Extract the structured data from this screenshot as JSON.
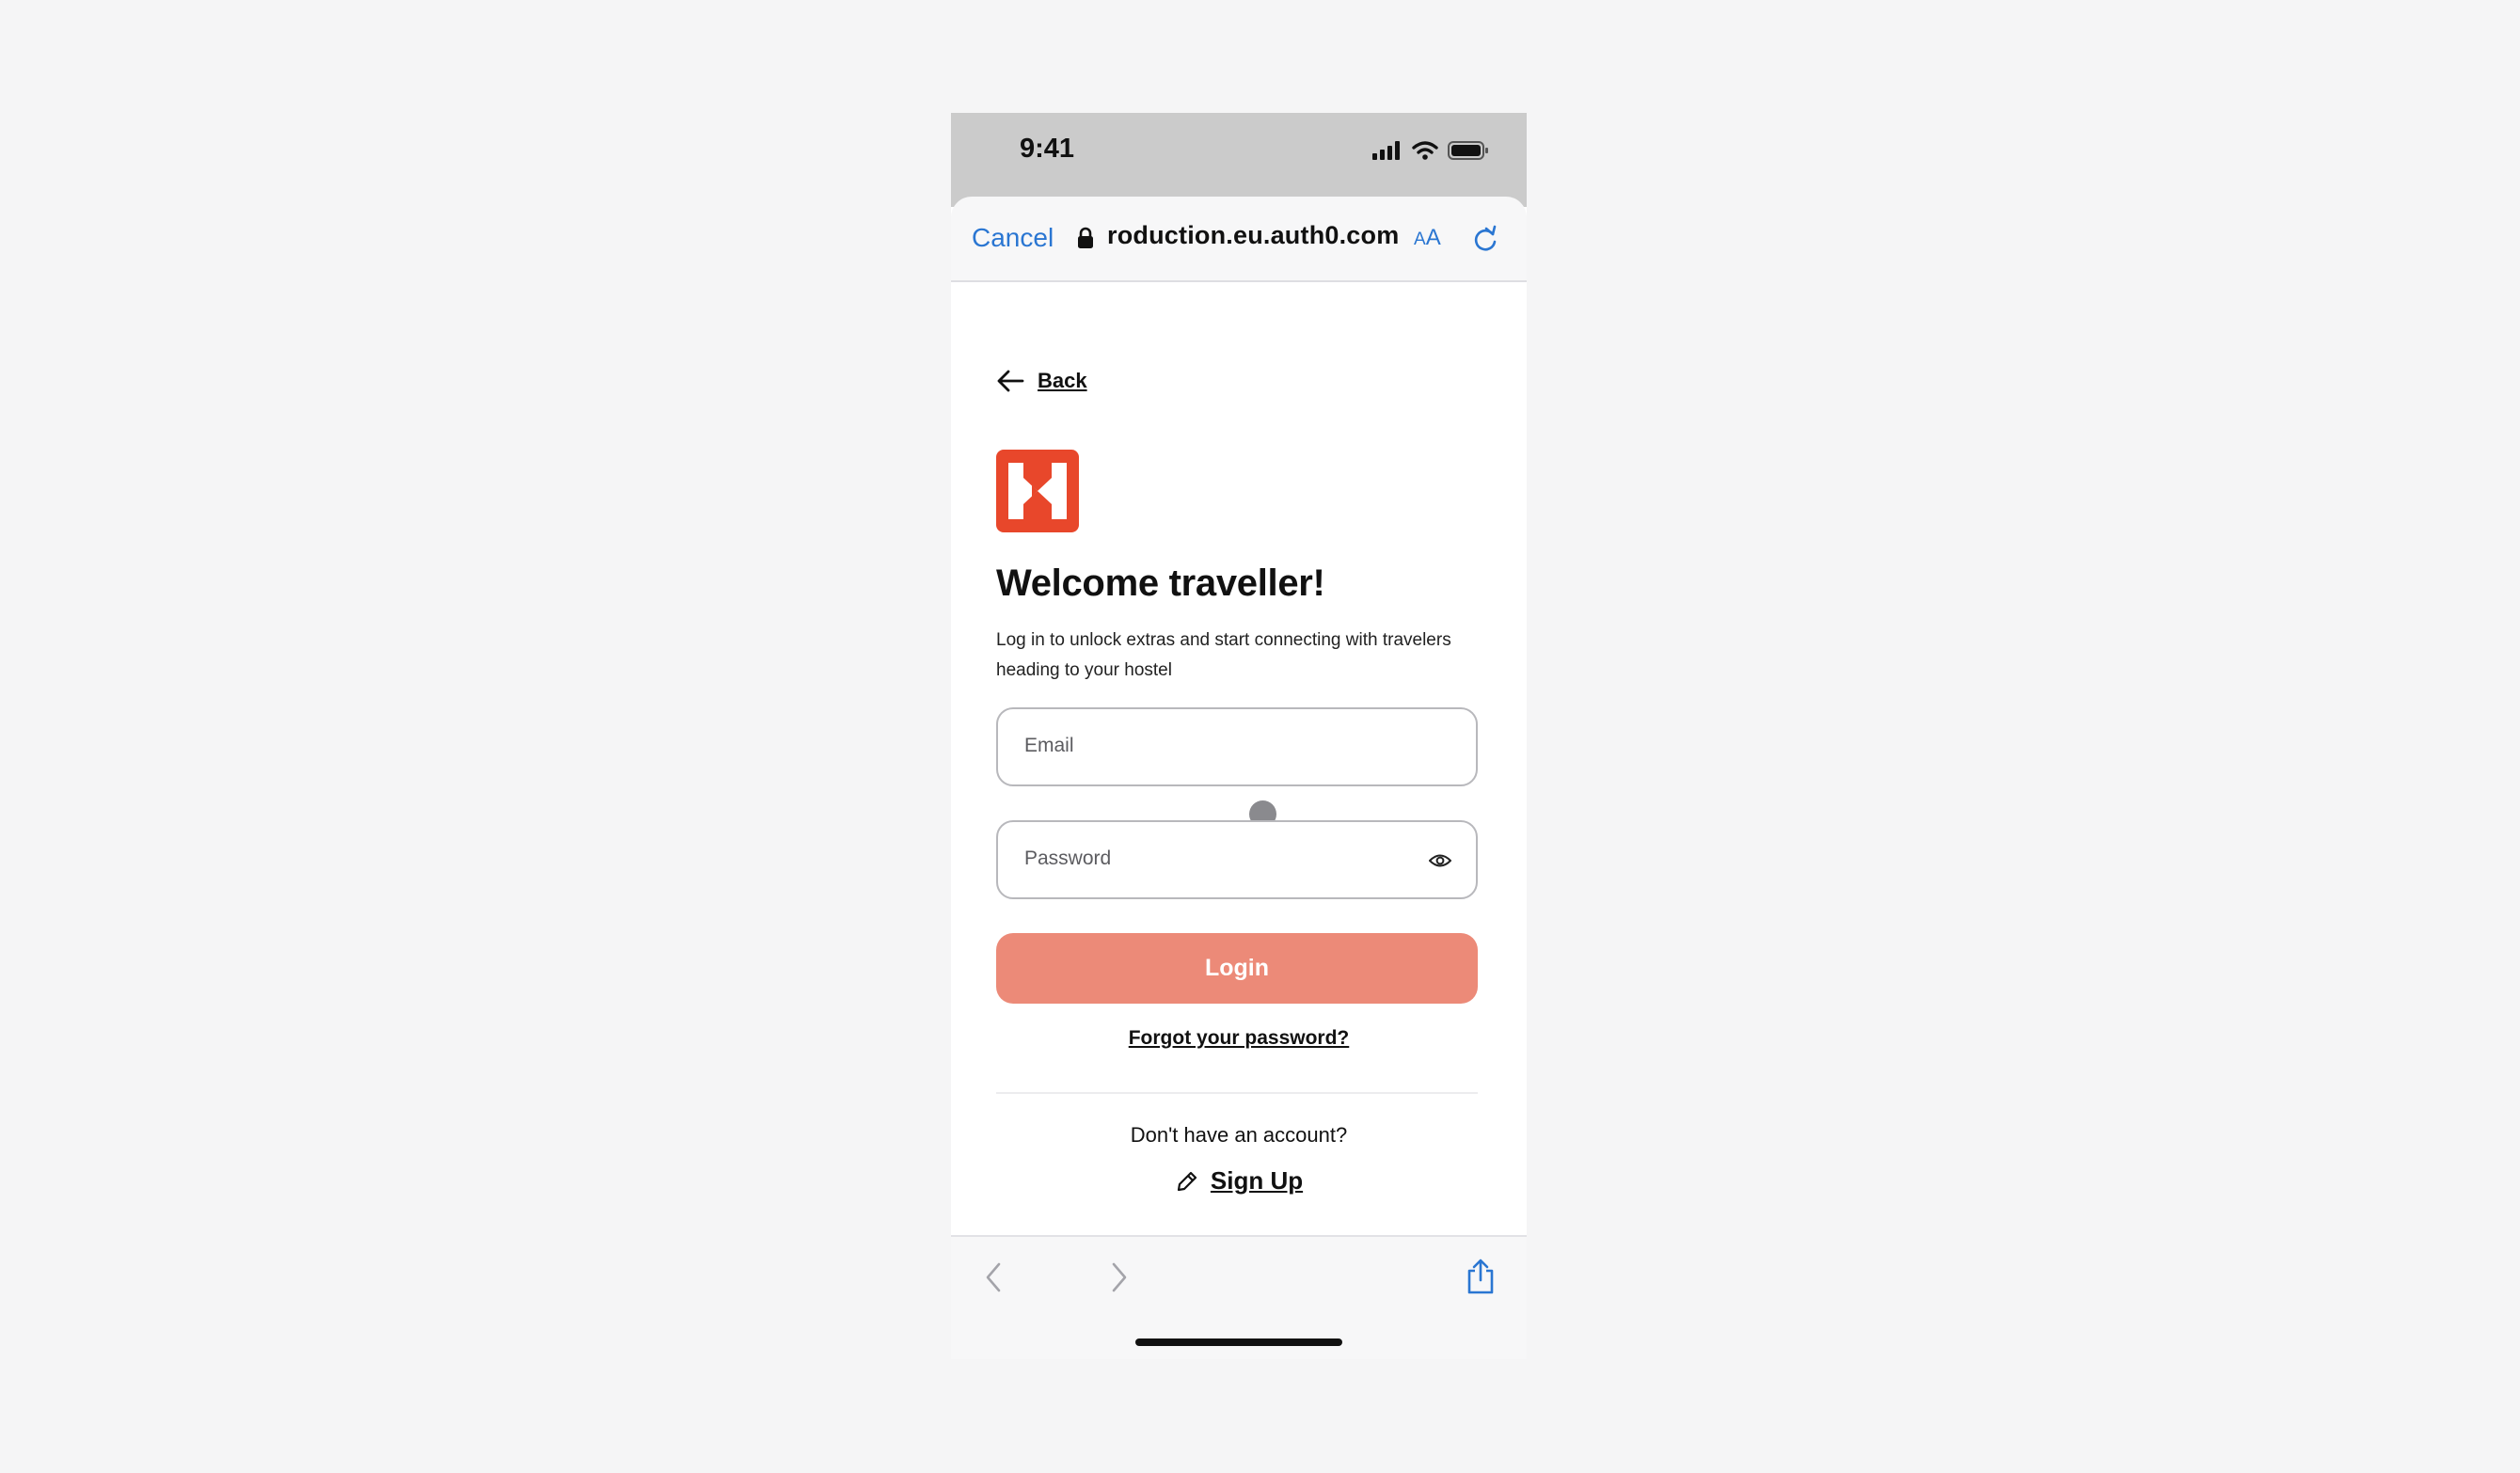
{
  "status_bar": {
    "time": "9:41"
  },
  "browser": {
    "cancel_label": "Cancel",
    "url": "roduction.eu.auth0.com",
    "text_size_small": "A",
    "text_size_large": "A"
  },
  "page": {
    "back_label": "Back",
    "title": "Welcome traveller!",
    "subtitle": "Log in to unlock extras and start connecting with travelers heading to your hostel",
    "email_placeholder": "Email",
    "password_placeholder": "Password",
    "login_label": "Login",
    "forgot_label": "Forgot your password?",
    "no_account_text": "Don't have an account?",
    "signup_label": "Sign Up"
  },
  "colors": {
    "brand": "#e8472b",
    "login_button": "#ec8a78",
    "browser_accent": "#2a76d2"
  },
  "icons": [
    "signal-icon",
    "wifi-icon",
    "battery-icon",
    "lock-icon",
    "reload-icon",
    "arrow-left-icon",
    "eye-icon",
    "pencil-icon",
    "chevron-left-icon",
    "chevron-right-icon",
    "share-icon"
  ]
}
